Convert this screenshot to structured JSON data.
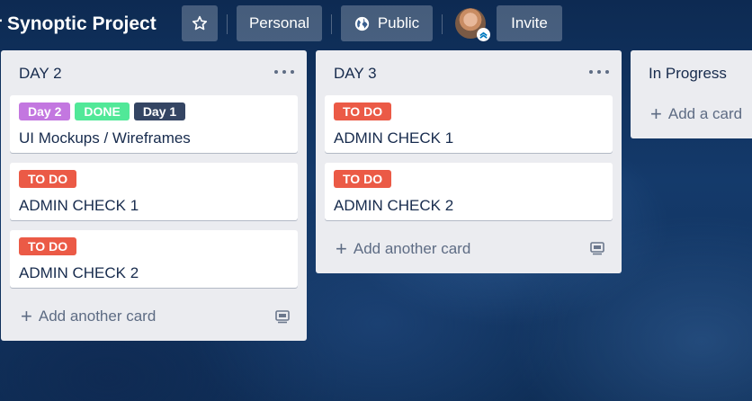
{
  "header": {
    "board_title": "r Synoptic Project",
    "star_icon": "star-icon",
    "personal_label": "Personal",
    "public_label": "Public",
    "public_icon": "globe-icon",
    "invite_label": "Invite"
  },
  "lists": [
    {
      "title": "DAY 2",
      "cards": [
        {
          "labels": [
            {
              "text": "Day 2",
              "color": "#c377e0"
            },
            {
              "text": "DONE",
              "color": "#51e898"
            },
            {
              "text": "Day 1",
              "color": "#344563"
            }
          ],
          "title": "UI Mockups / Wireframes"
        },
        {
          "labels": [
            {
              "text": "TO DO",
              "color": "#eb5a46"
            }
          ],
          "title": "ADMIN CHECK 1"
        },
        {
          "labels": [
            {
              "text": "TO DO",
              "color": "#eb5a46"
            }
          ],
          "title": "ADMIN CHECK 2"
        }
      ],
      "add_card_label": "Add another card"
    },
    {
      "title": "DAY 3",
      "cards": [
        {
          "labels": [
            {
              "text": "TO DO",
              "color": "#eb5a46"
            }
          ],
          "title": "ADMIN CHECK 1"
        },
        {
          "labels": [
            {
              "text": "TO DO",
              "color": "#eb5a46"
            }
          ],
          "title": "ADMIN CHECK 2"
        }
      ],
      "add_card_label": "Add another card"
    },
    {
      "title": "In Progress",
      "cards": [],
      "add_card_label": "Add a card"
    }
  ]
}
